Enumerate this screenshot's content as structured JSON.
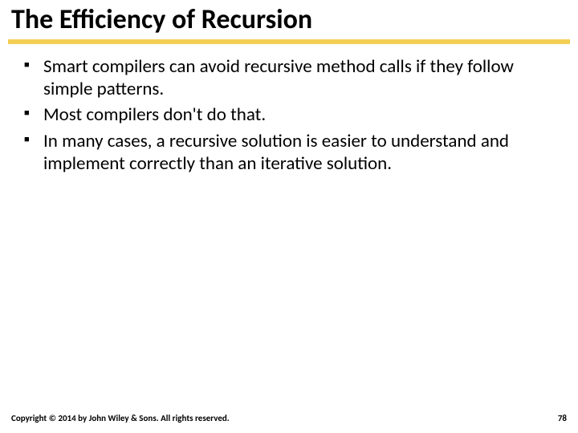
{
  "title": "The Efficiency of Recursion",
  "bullets": [
    "Smart compilers can avoid recursive method calls if they follow simple patterns.",
    "Most compilers don't do that.",
    "In many cases, a recursive solution is easier to understand and implement correctly than an iterative solution."
  ],
  "footer": {
    "copyright": "Copyright © 2014 by John Wiley & Sons. All rights reserved.",
    "page": "78"
  }
}
